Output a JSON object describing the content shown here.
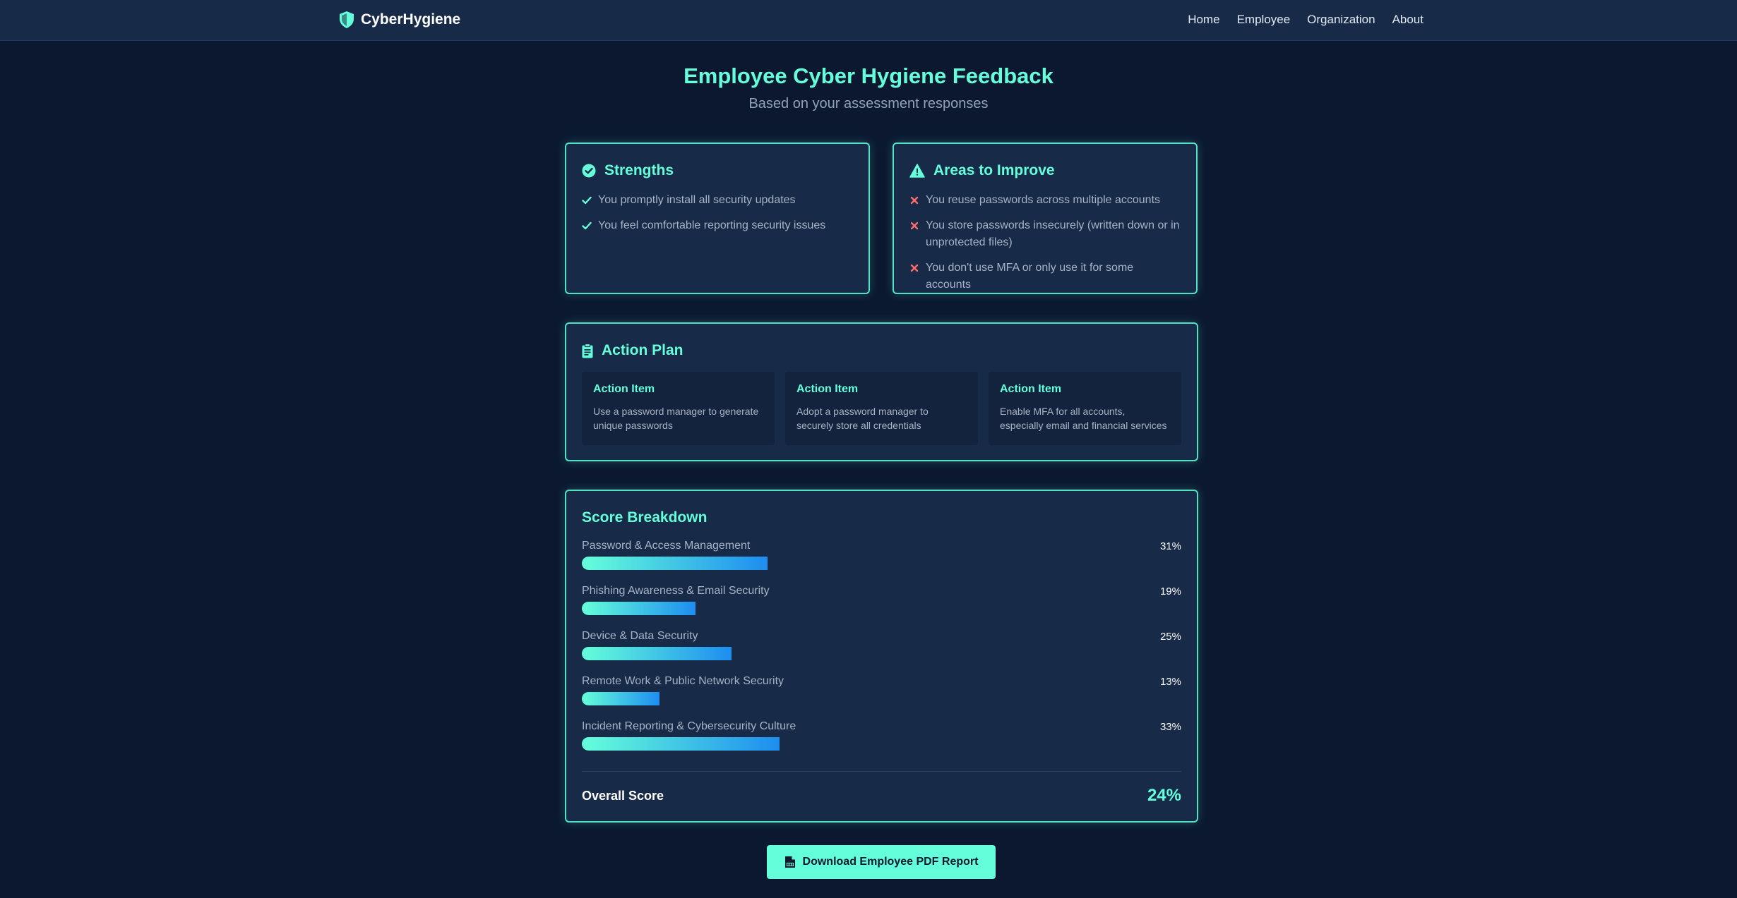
{
  "nav": {
    "brand": "CyberHygiene",
    "brand_icon": "shield-icon",
    "links": [
      "Home",
      "Employee",
      "Organization",
      "About"
    ]
  },
  "header": {
    "title": "Employee Cyber Hygiene Feedback",
    "subtitle": "Based on your assessment responses"
  },
  "strengths": {
    "title": "Strengths",
    "icon": "check-circle-icon",
    "items": [
      "You promptly install all security updates",
      "You feel comfortable reporting security issues"
    ]
  },
  "improve": {
    "title": "Areas to Improve",
    "icon": "warning-triangle-icon",
    "items": [
      "You reuse passwords across multiple accounts",
      "You store passwords insecurely (written down or in unprotected files)",
      "You don't use MFA or only use it for some accounts"
    ]
  },
  "action_plan": {
    "title": "Action Plan",
    "icon": "clipboard-icon",
    "items": [
      {
        "title": "Action Item",
        "text": "Use a password manager to generate unique passwords"
      },
      {
        "title": "Action Item",
        "text": "Adopt a password manager to securely store all credentials"
      },
      {
        "title": "Action Item",
        "text": "Enable MFA for all accounts, especially email and financial services"
      }
    ]
  },
  "score": {
    "title": "Score Breakdown",
    "rows": [
      {
        "label": "Password & Access Management",
        "value": "31%",
        "fraction": 0.31
      },
      {
        "label": "Phishing Awareness & Email Security",
        "value": "19%",
        "fraction": 0.19
      },
      {
        "label": "Device & Data Security",
        "value": "25%",
        "fraction": 0.25
      },
      {
        "label": "Remote Work & Public Network Security",
        "value": "13%",
        "fraction": 0.13
      },
      {
        "label": "Incident Reporting & Cybersecurity Culture",
        "value": "33%",
        "fraction": 0.33
      }
    ],
    "overall_label": "Overall Score",
    "overall_value": "24%"
  },
  "download": {
    "label": "Download Employee PDF Report",
    "icon": "pdf-file-icon"
  },
  "colors": {
    "accent": "#64ffda",
    "background": "#0b1830",
    "card": "#172a47",
    "error": "#ff6b6b",
    "bar_end": "#1e8df0"
  }
}
